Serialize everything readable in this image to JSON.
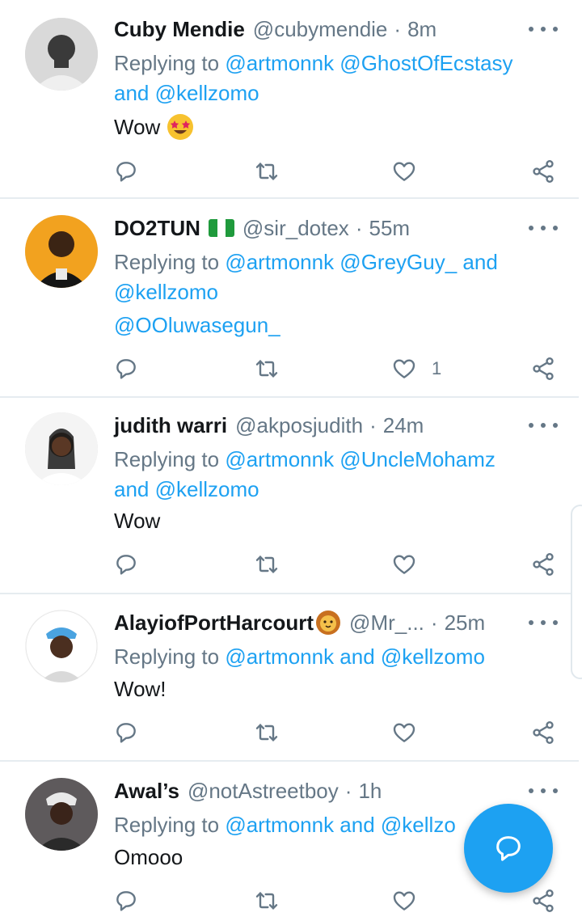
{
  "tweets": [
    {
      "name": "Cuby Mendie",
      "handle": "@cubymendie",
      "time": "8m",
      "reply_prefix": "Replying to",
      "reply_lines": [
        [
          {
            "t": "@artmonnk @GhostOfEcstasy",
            "m": true
          }
        ],
        [
          {
            "t": "and ",
            "m": true
          },
          {
            "t": "@kellzomo",
            "m": true
          }
        ]
      ],
      "text": "Wow",
      "emoji": "star-struck-emoji",
      "likes": ""
    },
    {
      "name": "DO2TUN",
      "flag": "nigeria-flag-icon",
      "handle": "@sir_dotex",
      "time": "55m",
      "reply_prefix": "Replying to",
      "reply_lines": [
        [
          {
            "t": "@artmonnk @GreyGuy_ and",
            "m": true
          }
        ],
        [
          {
            "t": "@kellzomo",
            "m": true
          }
        ],
        [
          {
            "t": "@OOluwasegun_",
            "m": true
          }
        ]
      ],
      "text": "",
      "likes": "1"
    },
    {
      "name": "judith warri",
      "handle": "@akposjudith",
      "time": "24m",
      "reply_prefix": "Replying to",
      "reply_lines": [
        [
          {
            "t": "@artmonnk @UncleMohamz",
            "m": true
          }
        ],
        [
          {
            "t": "and @kellzomo",
            "m": true
          }
        ]
      ],
      "text": "Wow",
      "likes": ""
    },
    {
      "name": "AlayiofPortHarcourt",
      "emoji": "lion-face-emoji",
      "handle": "@Mr_...",
      "time": "25m",
      "reply_prefix": "Replying to",
      "reply_lines": [
        [
          {
            "t": "@artmonnk and @kellzomo",
            "m": true
          }
        ]
      ],
      "text": "Wow!",
      "likes": ""
    },
    {
      "name": "Awal’s",
      "handle": "@notAstreetboy",
      "time": "1h",
      "reply_prefix": "Replying to",
      "reply_lines": [
        [
          {
            "t": "@artmonnk and @kellzo",
            "m": true
          }
        ]
      ],
      "text": "Omooo",
      "likes": ""
    }
  ],
  "icons": {
    "reply": "reply-icon",
    "retweet": "retweet-icon",
    "like": "heart-icon",
    "share": "share-icon",
    "more": "more-icon",
    "compose": "compose-reply-icon"
  },
  "colors": {
    "accent": "#1da1f2",
    "secondary_text": "#657786",
    "divider": "#e6ecf0"
  }
}
